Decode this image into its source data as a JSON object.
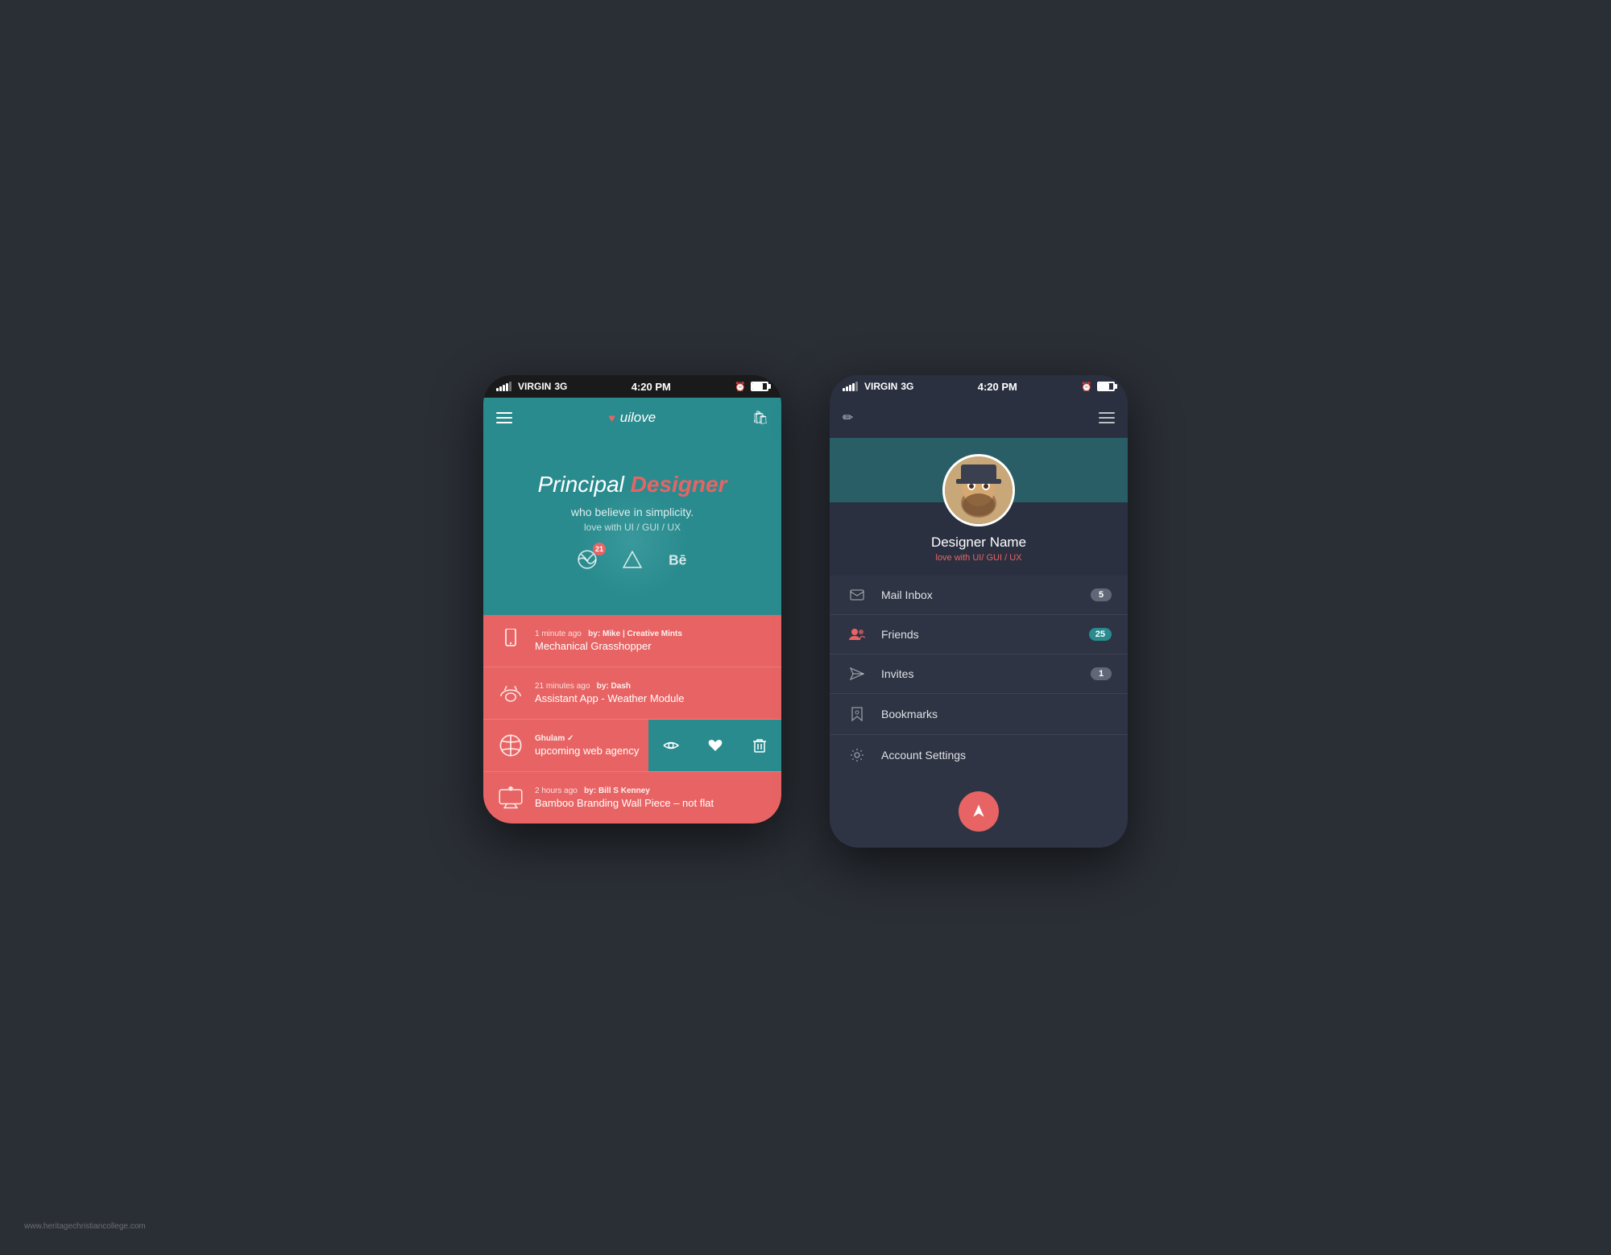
{
  "background": "#2a2e35",
  "watermark": "www.heritagechristiancollege.com",
  "phone1": {
    "statusBar": {
      "carrier": "VIRGIN",
      "network": "3G",
      "time": "4:20 PM"
    },
    "navbar": {
      "brandName": "uilove"
    },
    "hero": {
      "titleMain": "Principal",
      "titleAccent": "Designer",
      "subtitle": "who believe in simplicity.",
      "tagline": "love with UI / GUI / UX",
      "dribbbleBadge": "21"
    },
    "feed": {
      "items": [
        {
          "icon": "phone",
          "timeAgo": "1 minute ago",
          "by": "by: Mike | Creative Mints",
          "title": "Mechanical Grasshopper"
        },
        {
          "icon": "cloud",
          "timeAgo": "21 minutes ago",
          "by": "by: Dash",
          "title": "Assistant App - Weather Module"
        },
        {
          "icon": "globe",
          "timeAgo": "",
          "by": "Ghulam ✓",
          "title": "upcoming web agency",
          "hasSwipe": true
        },
        {
          "icon": "monitor",
          "timeAgo": "2 hours ago",
          "by": "by: Bill S Kenney",
          "title": "Bamboo Branding  Wall Piece – not flat"
        }
      ],
      "swipeActions": [
        "eye",
        "heart",
        "trash"
      ]
    }
  },
  "phone2": {
    "statusBar": {
      "carrier": "VIRGIN",
      "network": "3G",
      "time": "4:20 PM"
    },
    "profile": {
      "name": "Designer Name",
      "tagline": "love with UI/ GUI / UX"
    },
    "menu": {
      "items": [
        {
          "icon": "mail",
          "label": "Mail Inbox",
          "badge": "5",
          "badgeType": "gray",
          "active": false
        },
        {
          "icon": "friends",
          "label": "Friends",
          "badge": "25",
          "badgeType": "teal",
          "active": true
        },
        {
          "icon": "send",
          "label": "Invites",
          "badge": "1",
          "badgeType": "gray",
          "active": false
        },
        {
          "icon": "bookmark",
          "label": "Bookmarks",
          "badge": "",
          "badgeType": "",
          "active": false
        },
        {
          "icon": "settings",
          "label": "Account Settings",
          "badge": "",
          "badgeType": "",
          "active": false
        }
      ]
    },
    "logoutButton": "⏏"
  }
}
